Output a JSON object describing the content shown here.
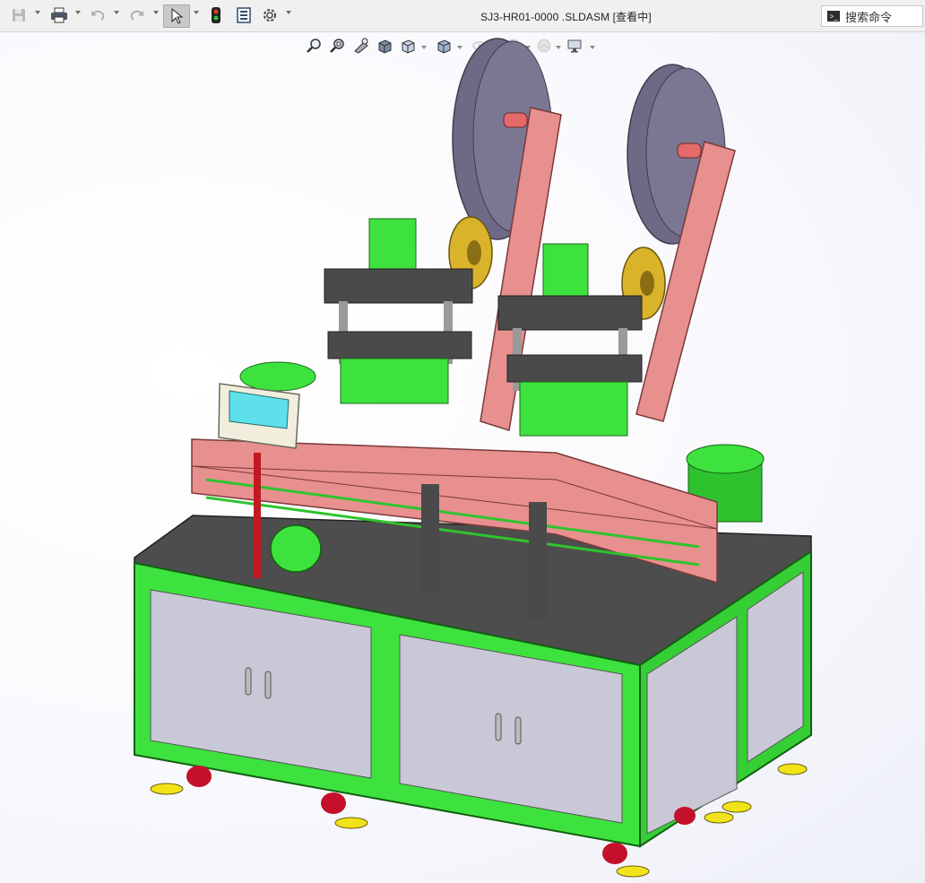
{
  "window": {
    "title": "SJ3-HR01-0000 .SLDASM [查看中]"
  },
  "search": {
    "placeholder": "搜索命令"
  },
  "toolbar": {
    "items": [
      {
        "name": "save",
        "icon": "save-icon"
      },
      {
        "name": "print",
        "icon": "printer-icon"
      },
      {
        "name": "undo",
        "icon": "undo-icon"
      },
      {
        "name": "redo",
        "icon": "redo-icon"
      },
      {
        "name": "select",
        "icon": "pointer-icon",
        "active": true
      },
      {
        "name": "rebuild",
        "icon": "traffic-light-icon"
      },
      {
        "name": "file-properties",
        "icon": "properties-icon"
      },
      {
        "name": "options",
        "icon": "gear-icon"
      }
    ]
  },
  "view_toolbar": {
    "items": [
      "zoom-to-fit-icon",
      "zoom-to-area-icon",
      "previous-view-icon",
      "section-view-icon",
      "view-orientation-icon",
      "display-style-icon",
      "hide-show-icon",
      "edit-appearance-icon",
      "apply-scene-icon",
      "view-settings-icon"
    ]
  },
  "colors": {
    "frame_green": "#3ee23e",
    "panel_grey": "#c8c8d6",
    "plate_dark": "#4a4a4a",
    "rail_pink": "#e88f8f",
    "reel_purple": "#6e6a86",
    "spool_yellow": "#d9b32a",
    "caster_red": "#c4102a",
    "foot_yellow": "#f2e21a"
  }
}
